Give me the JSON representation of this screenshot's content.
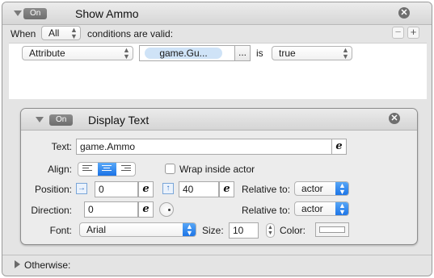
{
  "rule": {
    "on_label": "On",
    "title": "Show Ammo",
    "close_glyph": "✕",
    "when_label": "When",
    "when_value": "All",
    "conditions_text": "conditions are valid:",
    "remove_glyph": "−",
    "add_glyph": "+",
    "condition": {
      "type_value": "Attribute",
      "attribute_token": "game.Gu...",
      "picker_glyph": "...",
      "operator": "is",
      "value": "true"
    },
    "otherwise_label": "Otherwise:"
  },
  "behavior": {
    "on_label": "On",
    "title": "Display Text",
    "close_glyph": "✕",
    "text_label": "Text:",
    "text_value": "game.Ammo",
    "expression_glyph": "e",
    "align_label": "Align:",
    "align_options": [
      "left",
      "center",
      "right"
    ],
    "align_selected": "center",
    "wrap_label": "Wrap inside actor",
    "wrap_checked": false,
    "position_label": "Position:",
    "position_x": "0",
    "position_y": "40",
    "x_arrow_glyph": "→",
    "y_arrow_glyph": "↑",
    "relative_label": "Relative to:",
    "position_relative": "actor",
    "direction_label": "Direction:",
    "direction_value": "0",
    "direction_relative": "actor",
    "font_label": "Font:",
    "font_value": "Arial",
    "size_label": "Size:",
    "size_value": "10",
    "color_label": "Color:",
    "color_value": "#ffffff"
  },
  "icons": {
    "collapse": "disclosure-triangle-down-icon",
    "expand": "disclosure-triangle-right-icon",
    "close": "close-circle-icon",
    "popup_arrows": "up-down-arrows-icon",
    "expression": "expression-e-icon",
    "dial": "direction-dial-icon"
  }
}
